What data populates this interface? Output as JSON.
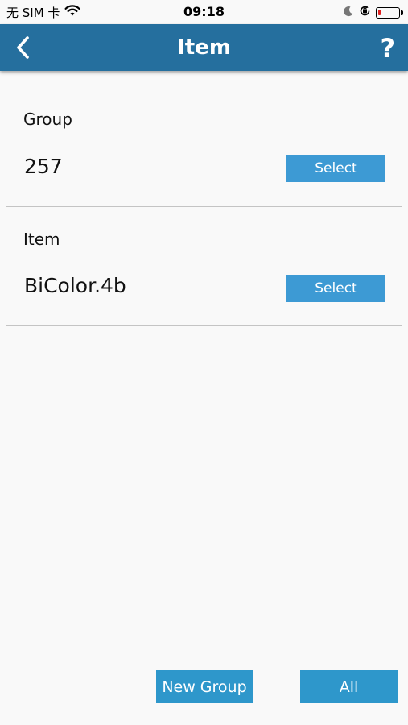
{
  "status_bar": {
    "carrier": "无 SIM 卡",
    "time": "09:18",
    "battery_level": 0.1,
    "icons": [
      "wifi-icon",
      "moon-icon",
      "orientation-lock-icon",
      "battery-icon"
    ]
  },
  "nav": {
    "title": "Item",
    "back_icon": "chevron-left-icon",
    "help_label": "?"
  },
  "group_section": {
    "label": "Group",
    "value": "257",
    "button_label": "Select"
  },
  "item_section": {
    "label": "Item",
    "value": "BiColor.4b",
    "button_label": "Select"
  },
  "footer": {
    "new_group_label": "New Group",
    "all_label": "All"
  },
  "colors": {
    "nav_background": "#256f9e",
    "select_button": "#3d9ad4",
    "footer_button": "#2e97cb",
    "page_background": "#f9f9f9"
  }
}
